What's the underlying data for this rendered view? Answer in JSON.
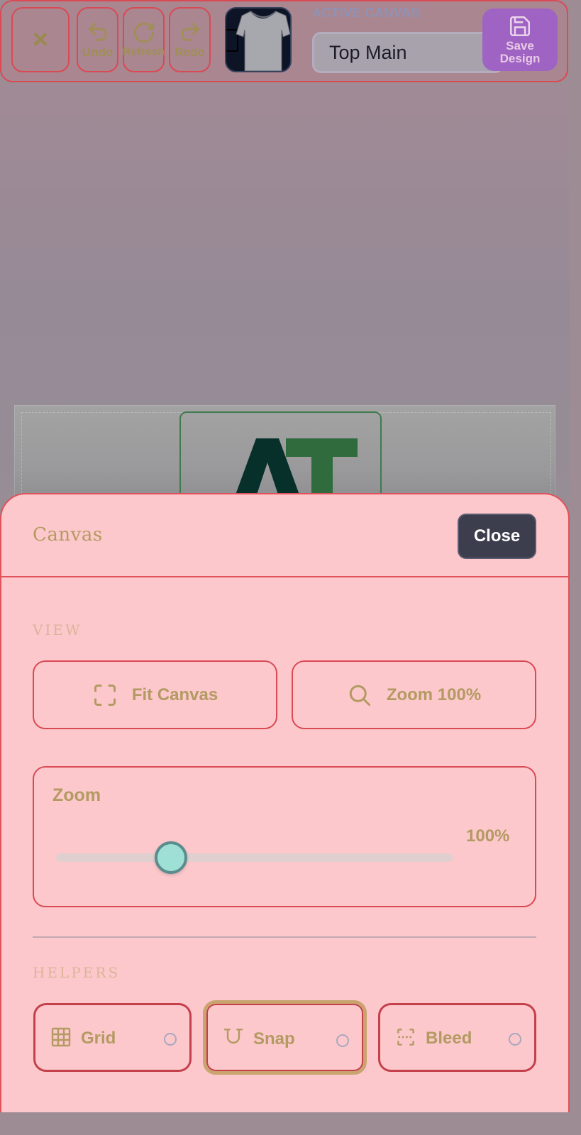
{
  "toolbar": {
    "close_label": "×",
    "undo_label": "Undo",
    "refresh_label": "Refresh",
    "redo_label": "Redo",
    "active_canvas_label": "ACTIVE CANVAS",
    "active_canvas_value": "Top Main",
    "save_label_line1": "Save",
    "save_label_line2": "Design"
  },
  "canvas": {
    "logo_text": "AT"
  },
  "sheet": {
    "title": "Canvas",
    "close_label": "Close",
    "view_section_label": "VIEW",
    "fit_canvas_label": "Fit Canvas",
    "zoom_100_label": "Zoom 100%",
    "zoom": {
      "title": "Zoom",
      "value_label": "100%",
      "slider_fraction": 0.29
    },
    "helpers_section_label": "HELPERS",
    "helpers": [
      {
        "label": "Grid",
        "icon": "grid-icon",
        "enabled": false
      },
      {
        "label": "Snap",
        "icon": "magnet-icon",
        "enabled": false
      },
      {
        "label": "Bleed",
        "icon": "bleed-icon",
        "enabled": false
      }
    ]
  },
  "colors": {
    "accent_red": "#d94a55",
    "sheet_bg": "#fcc8cb",
    "save_purple": "#9f63c4",
    "slider_thumb": "#9fe0d6",
    "label_gold": "#b39a62",
    "close_dark": "#3c3d4d"
  }
}
